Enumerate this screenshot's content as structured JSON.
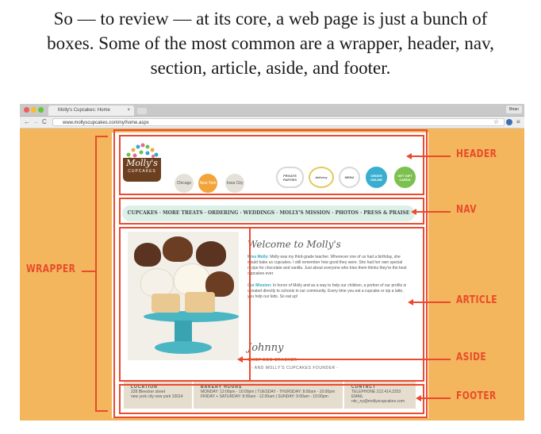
{
  "caption": {
    "line1": "So — to review — at its core, a web page is just a bunch of",
    "line2": "boxes. Some of the most common are a wrapper, header, nav,",
    "line3": "section, article, aside, and footer."
  },
  "browser": {
    "tab_title": "Molly's Cupcakes: Home",
    "tab_close": "×",
    "user_name": "Brian",
    "url": "www.mollyscupcakes.com/ny/home.aspx",
    "back_icon": "←",
    "forward_icon": "→",
    "reload_icon": "C",
    "star_icon": "☆",
    "menu_icon": "≡"
  },
  "site": {
    "logo_line1": "Molly's",
    "logo_line2": "CUPCAKES",
    "cities": [
      "Chicago",
      "New York",
      "Iowa City"
    ],
    "header_buttons": [
      "PRIVATE PARTIES",
      "delivery",
      "MENU",
      "ORDER ONLINE",
      "GET GIFT CARDS"
    ],
    "nav_text": "CUPCAKES · MORE TREATS · ORDERING · WEDDINGS · MOLLY'S MISSION · PHOTOS · PRESS & PRAISE",
    "article": {
      "title": "Welcome to Molly's",
      "p1_highlight": "Miss Molly:",
      "p1_text": " Molly was my third-grade teacher. Whenever one of us had a birthday, she would bake us cupcakes. I still remember how good they were. She had her own special recipe for chocolate and vanilla. Just about everyone who tries them thinks they're the best cupcakes ever.",
      "p2_highlight": "Our Mission:",
      "p2_text": " In honor of Molly and as a way to help our children, a portion of our profits is donated directly to schools in our community. Every time you eat a cupcake or sip a latte, you help our kids. So eat up!",
      "signature": "Johnny",
      "chef_title": "CHIEF EGG CRACKER",
      "founder": "- AND MOLLY'S CUPCAKES FOUNDER -"
    },
    "footer": {
      "location_title": "LOCATION",
      "location_l1": "228 Bleecker street",
      "location_l2": "new york city new york 10014",
      "hours_title": "BAKERY HOURS",
      "hours_l1": "MONDAY: 12:00pm - 10:00pm | TUESDAY - THURSDAY: 8:00am - 10:00pm",
      "hours_l2": "FRIDAY + SATURDAY: 8:00am - 12:00am | SUNDAY: 9:00am - 10:00pm",
      "contact_title": "CONTACT",
      "contact_l1": "TELEPHONE 212.414.2253",
      "contact_l2": "EMAIL nkc_ny@mollyscupcakes.com"
    }
  },
  "labels": {
    "header": "HEADER",
    "nav": "NAV",
    "wrapper": "WRAPPER",
    "article": "ARTICLE",
    "aside": "ASIDE",
    "footer": "FOOTER"
  },
  "colors": {
    "annotation": "#ea4a2e",
    "background": "#f3b65c",
    "accent_teal": "#2ea5c0",
    "city_active": "#f2a43a"
  }
}
